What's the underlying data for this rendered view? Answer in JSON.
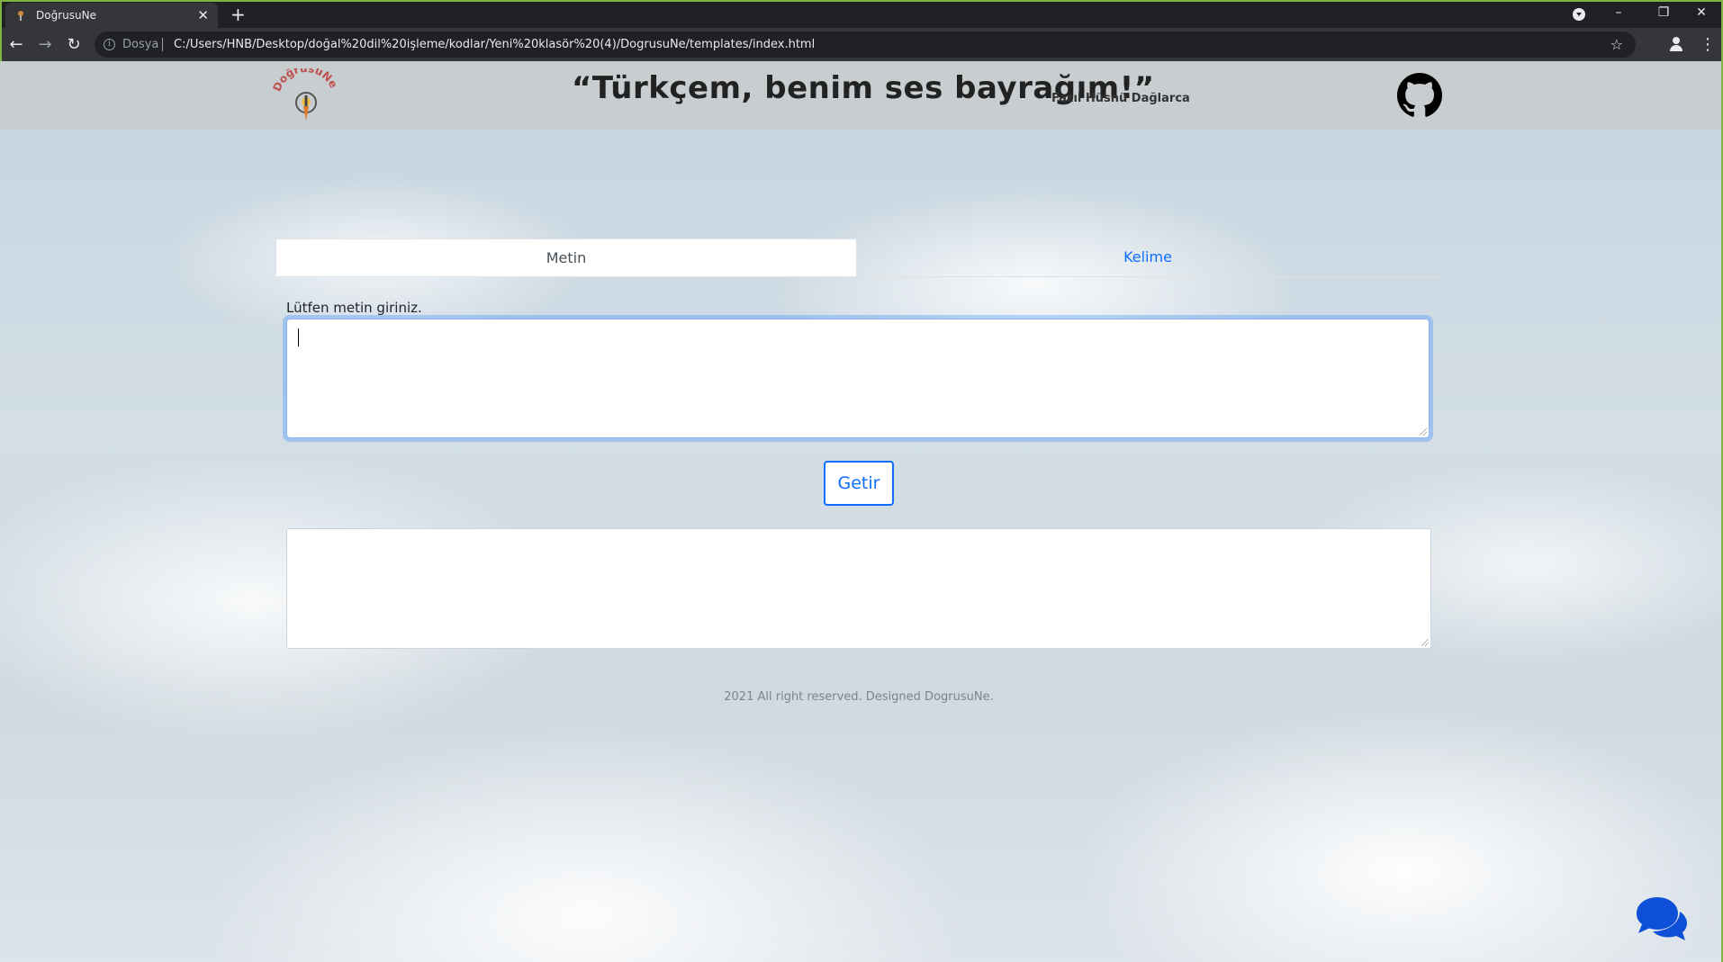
{
  "browser": {
    "tab_title": "DoğrusuNe",
    "tab_close": "✕",
    "new_tab": "+",
    "scheme_label": "Dosya",
    "url": "C:/Users/HNB/Desktop/doğal%20dil%20işleme/kodlar/Yeni%20klasör%20(4)/DogrusuNe/templates/index.html",
    "back": "←",
    "forward": "→",
    "reload": "↻",
    "star": "☆",
    "menu": "⋮",
    "minimize": "–",
    "restore": "❐",
    "close": "✕"
  },
  "header": {
    "logo_text": "DoğrusuNe",
    "slogan": "“Türkçem, benim ses bayrağım!”",
    "author": "Fazıl Hüsnü Dağlarca",
    "github_icon": "github-icon"
  },
  "tabs": [
    {
      "label": "Metin",
      "active": true
    },
    {
      "label": "Kelime",
      "active": false
    }
  ],
  "form": {
    "input_label": "Lütfen metin giriniz.",
    "input_value": "",
    "submit_label": "Getir",
    "output_value": ""
  },
  "footer": {
    "text": "2021 All right reserved. Designed DogrusuNe."
  },
  "colors": {
    "primary": "#0d6efd",
    "chrome_bg": "#202124",
    "window_border": "#7fb342"
  }
}
